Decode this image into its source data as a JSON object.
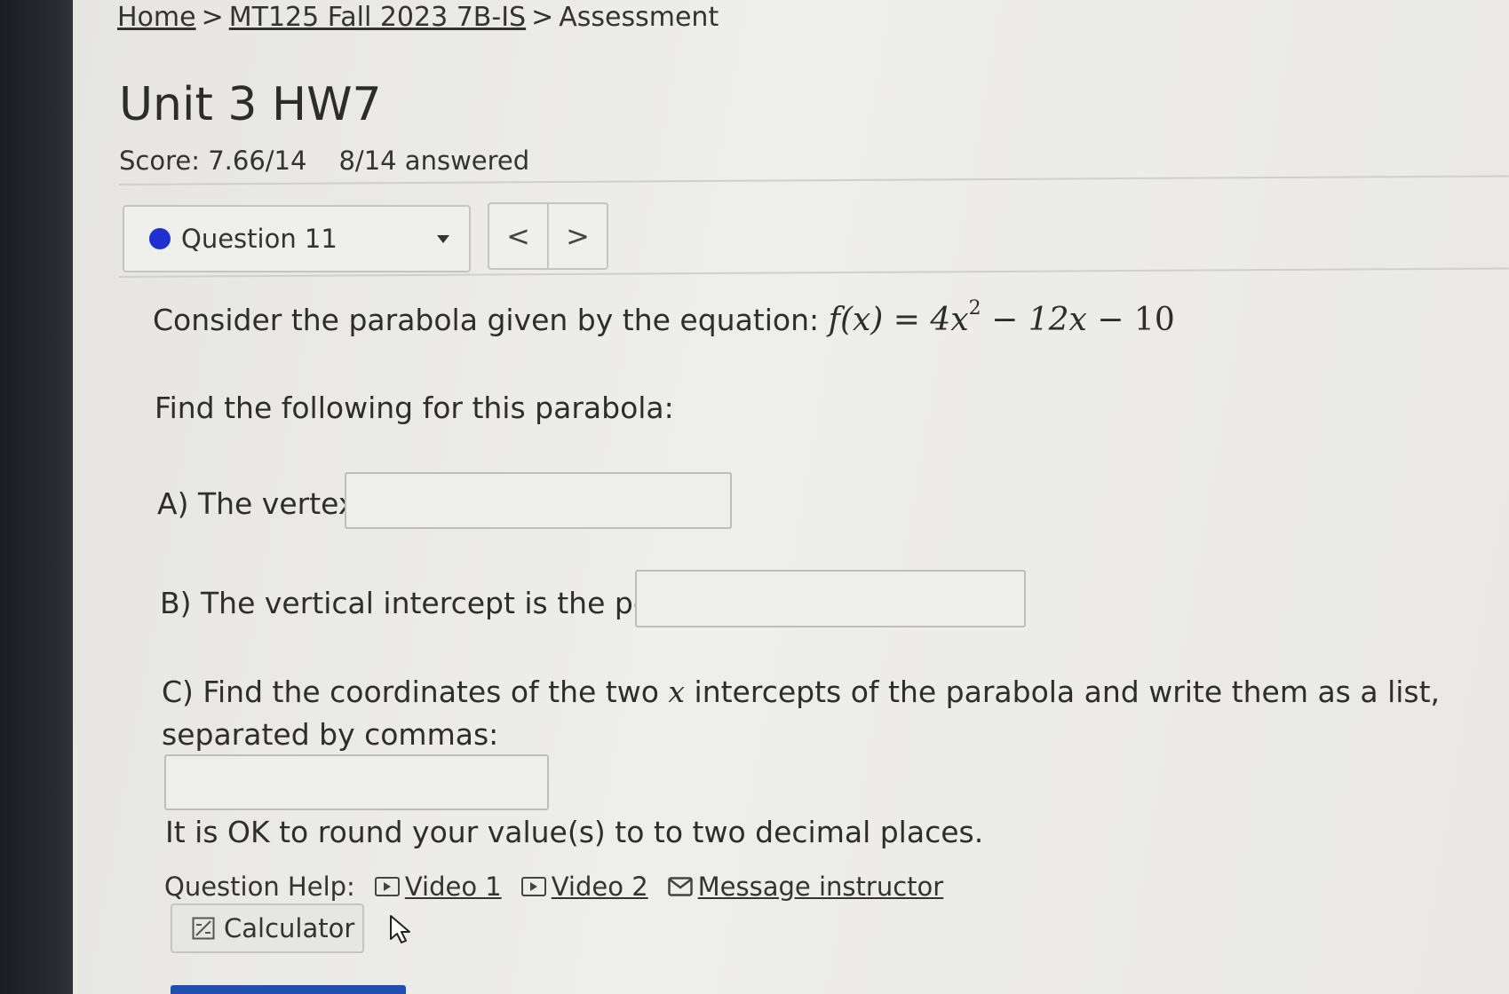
{
  "breadcrumb": {
    "home": "Home",
    "course": "MT125 Fall 2023 7B-IS",
    "current": "Assessment",
    "separator": ">"
  },
  "title": "Unit 3 HW7",
  "score": {
    "label": "Score: 7.66/14",
    "answered": "8/14 answered"
  },
  "question_nav": {
    "current_label": "Question 11",
    "prev_symbol": "<",
    "next_symbol": ">"
  },
  "question": {
    "intro": "Consider the parabola given by the equation:",
    "equation": {
      "lhs": "f(x)",
      "eq": "=",
      "t1": "4x",
      "t1_exp": "2",
      "op1": "−",
      "t2": "12x",
      "op2": "−",
      "t3": "10"
    },
    "find": "Find the following for this parabola:",
    "part_a": "A) The vertex:",
    "part_a_value": "",
    "part_b": "B) The vertical intercept is the point",
    "part_b_value": "",
    "part_c_pre": "C) Find the coordinates of the two",
    "part_c_var": "x",
    "part_c_post": "intercepts of the parabola and write them as a list,",
    "part_c_line2": "separated by commas:",
    "part_c_value": "",
    "rounding_note": "It is OK to round your value(s) to to two decimal places."
  },
  "help": {
    "label": "Question Help:",
    "video1": "Video 1",
    "video2": "Video 2",
    "message": "Message instructor",
    "calculator": "Calculator"
  },
  "colors": {
    "status_dot": "#1f2fd0",
    "submit_button": "#1f4fb0"
  }
}
